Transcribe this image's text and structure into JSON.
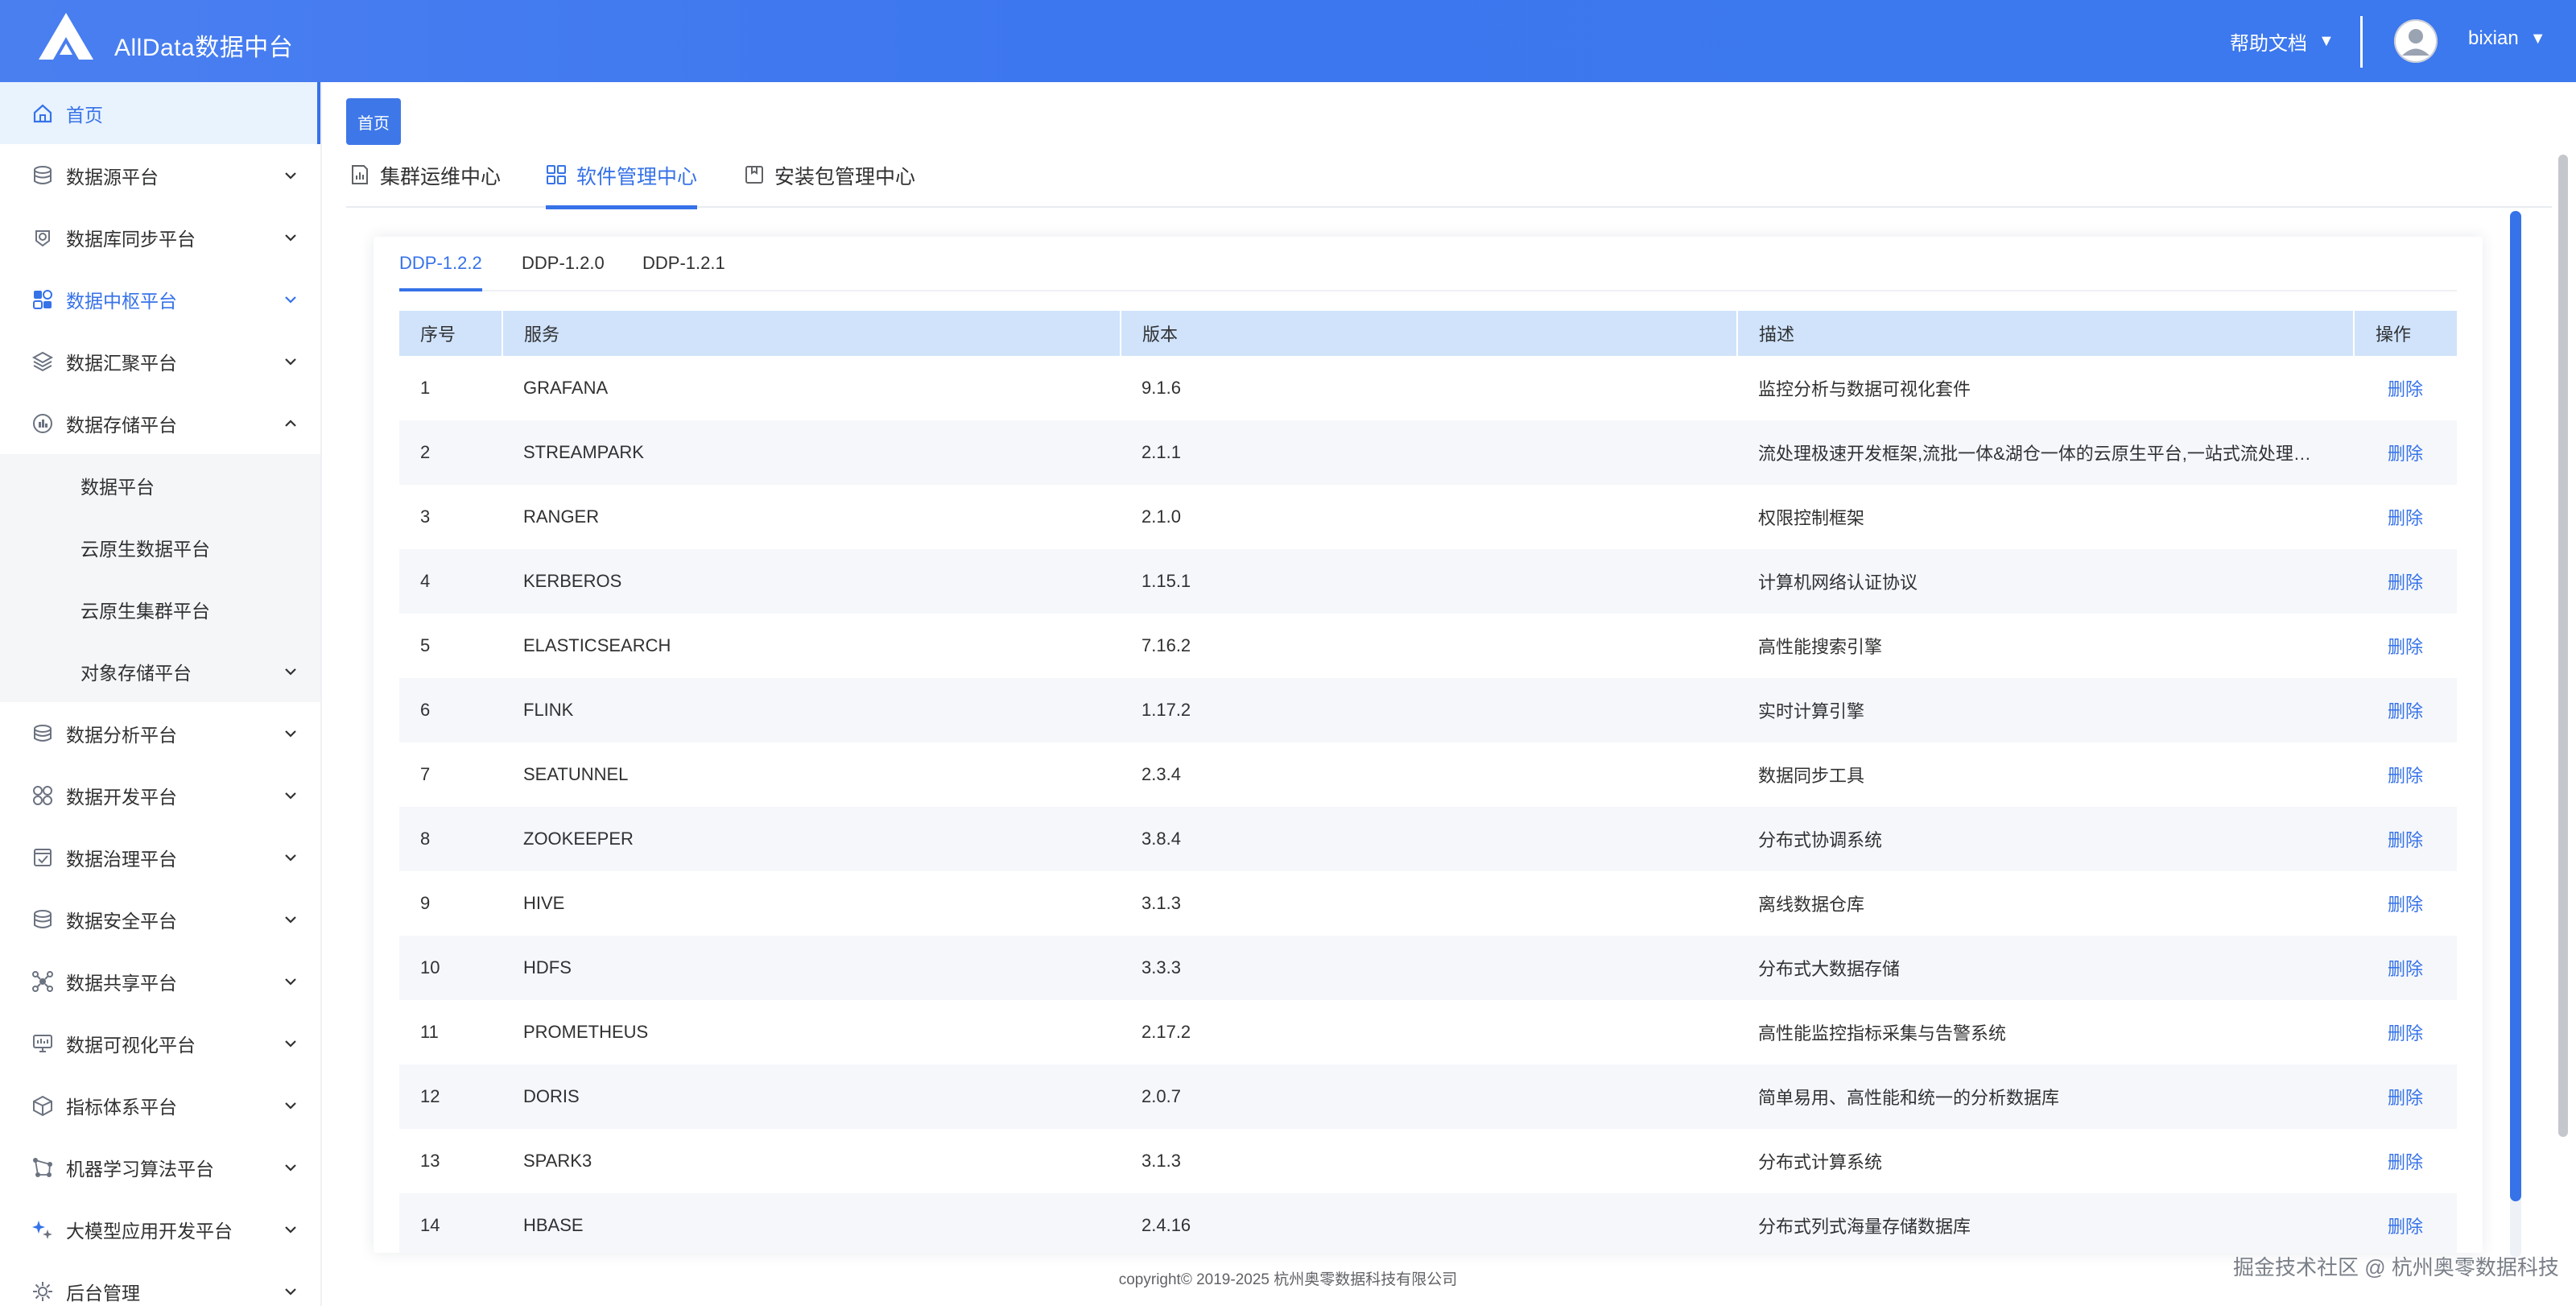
{
  "header": {
    "app_title": "AllData数据中台",
    "help_label": "帮助文档",
    "username": "bixian",
    "caret": "▼"
  },
  "sidebar": {
    "items": [
      {
        "label": "首页",
        "icon": "home-icon",
        "state": "active"
      },
      {
        "label": "数据源平台",
        "icon": "database-icon",
        "chevron": "down"
      },
      {
        "label": "数据库同步平台",
        "icon": "sync-icon",
        "chevron": "down"
      },
      {
        "label": "数据中枢平台",
        "icon": "hub-icon",
        "chevron": "down",
        "state": "highlight"
      },
      {
        "label": "数据汇聚平台",
        "icon": "layers-icon",
        "chevron": "down"
      },
      {
        "label": "数据存储平台",
        "icon": "storage-icon",
        "chevron": "up",
        "expanded": true
      }
    ],
    "submenu": [
      {
        "label": "数据平台"
      },
      {
        "label": "云原生数据平台"
      },
      {
        "label": "云原生集群平台"
      },
      {
        "label": "对象存储平台",
        "chevron": "down"
      }
    ],
    "items_after": [
      {
        "label": "数据分析平台",
        "icon": "analysis-icon",
        "chevron": "down"
      },
      {
        "label": "数据开发平台",
        "icon": "grid-icon",
        "chevron": "down"
      },
      {
        "label": "数据治理平台",
        "icon": "governance-icon",
        "chevron": "down"
      },
      {
        "label": "数据安全平台",
        "icon": "security-icon",
        "chevron": "down"
      },
      {
        "label": "数据共享平台",
        "icon": "share-icon",
        "chevron": "down"
      },
      {
        "label": "数据可视化平台",
        "icon": "monitor-icon",
        "chevron": "down"
      },
      {
        "label": "指标体系平台",
        "icon": "metrics-icon",
        "chevron": "down"
      },
      {
        "label": "机器学习算法平台",
        "icon": "ml-icon",
        "chevron": "down"
      },
      {
        "label": "大模型应用开发平台",
        "icon": "ai-icon",
        "chevron": "down"
      },
      {
        "label": "后台管理",
        "icon": "settings-icon",
        "chevron": "down"
      }
    ]
  },
  "breadcrumb": {
    "home_tag": "首页"
  },
  "main_tabs": [
    {
      "label": "集群运维中心",
      "icon": "chart-doc-icon"
    },
    {
      "label": "软件管理中心",
      "icon": "apps-icon",
      "active": true
    },
    {
      "label": "安装包管理中心",
      "icon": "package-icon"
    }
  ],
  "version_tabs": [
    {
      "label": "DDP-1.2.2",
      "active": true
    },
    {
      "label": "DDP-1.2.0"
    },
    {
      "label": "DDP-1.2.1"
    }
  ],
  "table": {
    "columns": [
      "序号",
      "服务",
      "版本",
      "描述",
      "操作"
    ],
    "rows": [
      {
        "no": "1",
        "service": "GRAFANA",
        "version": "9.1.6",
        "desc": "监控分析与数据可视化套件",
        "action": "删除"
      },
      {
        "no": "2",
        "service": "STREAMPARK",
        "version": "2.1.1",
        "desc": "流处理极速开发框架,流批一体&湖仓一体的云原生平台,一站式流处理…",
        "action": "删除"
      },
      {
        "no": "3",
        "service": "RANGER",
        "version": "2.1.0",
        "desc": "权限控制框架",
        "action": "删除"
      },
      {
        "no": "4",
        "service": "KERBEROS",
        "version": "1.15.1",
        "desc": "计算机网络认证协议",
        "action": "删除"
      },
      {
        "no": "5",
        "service": "ELASTICSEARCH",
        "version": "7.16.2",
        "desc": "高性能搜索引擎",
        "action": "删除"
      },
      {
        "no": "6",
        "service": "FLINK",
        "version": "1.17.2",
        "desc": "实时计算引擎",
        "action": "删除"
      },
      {
        "no": "7",
        "service": "SEATUNNEL",
        "version": "2.3.4",
        "desc": "数据同步工具",
        "action": "删除"
      },
      {
        "no": "8",
        "service": "ZOOKEEPER",
        "version": "3.8.4",
        "desc": "分布式协调系统",
        "action": "删除"
      },
      {
        "no": "9",
        "service": "HIVE",
        "version": "3.1.3",
        "desc": "离线数据仓库",
        "action": "删除"
      },
      {
        "no": "10",
        "service": "HDFS",
        "version": "3.3.3",
        "desc": "分布式大数据存储",
        "action": "删除"
      },
      {
        "no": "11",
        "service": "PROMETHEUS",
        "version": "2.17.2",
        "desc": "高性能监控指标采集与告警系统",
        "action": "删除"
      },
      {
        "no": "12",
        "service": "DORIS",
        "version": "2.0.7",
        "desc": "简单易用、高性能和统一的分析数据库",
        "action": "删除"
      },
      {
        "no": "13",
        "service": "SPARK3",
        "version": "3.1.3",
        "desc": "分布式计算系统",
        "action": "删除"
      },
      {
        "no": "14",
        "service": "HBASE",
        "version": "2.4.16",
        "desc": "分布式列式海量存储数据库",
        "action": "删除"
      }
    ]
  },
  "footer": {
    "copyright": "copyright© 2019-2025 杭州奥零数据科技有限公司"
  },
  "watermark": "掘金技术社区 @ 杭州奥零数据科技",
  "colors": {
    "accent": "#3672e8",
    "header": "#3d77ef",
    "table_header": "#d0e3fb"
  }
}
